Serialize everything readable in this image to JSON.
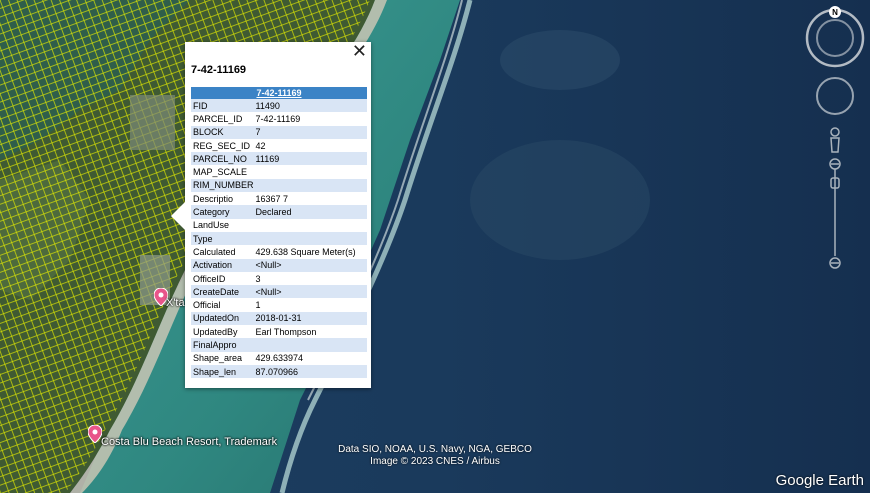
{
  "popup": {
    "title": "7-42-11169",
    "table_header": "7-42-11169",
    "close_glyph": "✕",
    "rows": [
      {
        "key": "FID",
        "value": "11490"
      },
      {
        "key": "PARCEL_ID",
        "value": "7-42-11169"
      },
      {
        "key": "BLOCK",
        "value": "7"
      },
      {
        "key": "REG_SEC_ID",
        "value": "42"
      },
      {
        "key": "PARCEL_NO",
        "value": "11169"
      },
      {
        "key": "MAP_SCALE",
        "value": ""
      },
      {
        "key": "RIM_NUMBER",
        "value": ""
      },
      {
        "key": "Descriptio",
        "value": "16367 7"
      },
      {
        "key": "Category",
        "value": "Declared"
      },
      {
        "key": "LandUse",
        "value": ""
      },
      {
        "key": "Type",
        "value": ""
      },
      {
        "key": "Calculated",
        "value": "429.638 Square Meter(s)"
      },
      {
        "key": "Activation",
        "value": "<Null>"
      },
      {
        "key": "OfficeID",
        "value": "3"
      },
      {
        "key": "CreateDate",
        "value": "<Null>"
      },
      {
        "key": "Official",
        "value": "1"
      },
      {
        "key": "UpdatedOn",
        "value": "2018-01-31"
      },
      {
        "key": "UpdatedBy",
        "value": "Earl Thompson"
      },
      {
        "key": "FinalAppro",
        "value": ""
      },
      {
        "key": "Shape_area",
        "value": "429.633974"
      },
      {
        "key": "Shape_len",
        "value": "87.070966"
      }
    ]
  },
  "placemarks": [
    {
      "label": "X'ta"
    },
    {
      "label": "Costa Blu Beach Resort, Trademark"
    }
  ],
  "attribution": {
    "line1": "Data SIO, NOAA, U.S. Navy, NGA, GEBCO",
    "line2": "Image © 2023 CNES / Airbus"
  },
  "brand": "Google Earth",
  "navigation": {
    "north_label": "N",
    "icons": [
      "compass-icon",
      "look-joystick-icon",
      "move-joystick-icon",
      "street-view-pegman-icon",
      "zoom-slider-icon"
    ]
  },
  "colors": {
    "parcel_lines": "#e8f000",
    "table_header": "#3b83c6",
    "table_alt_row": "#d9e5f5",
    "placemark": "#e8558a"
  }
}
